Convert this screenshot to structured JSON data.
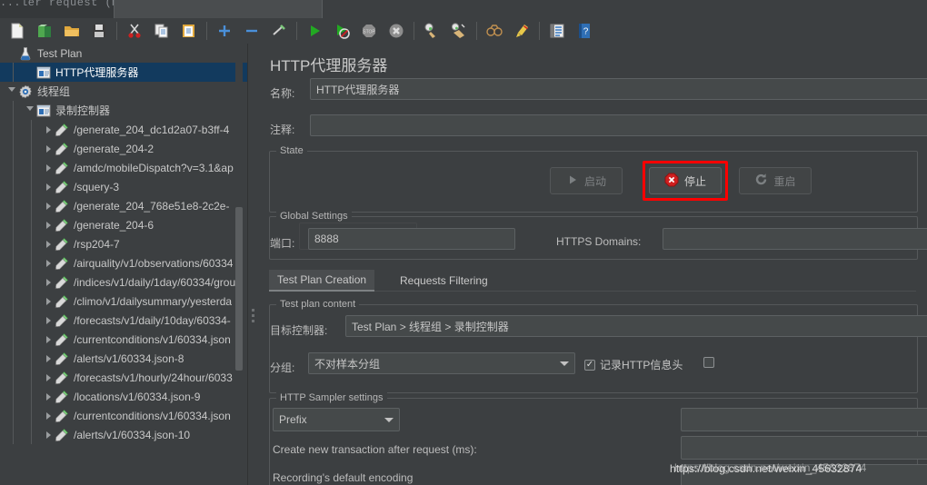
{
  "window": {
    "stray_title_fragment": "...ler request (ms):"
  },
  "toolbar": {
    "items": [
      {
        "name": "new-icon",
        "glyph": "new"
      },
      {
        "name": "templates-icon",
        "glyph": "templates"
      },
      {
        "name": "open-icon",
        "glyph": "open"
      },
      {
        "name": "save-icon",
        "glyph": "save"
      },
      {
        "name": "separator",
        "glyph": "sep"
      },
      {
        "name": "cut-icon",
        "glyph": "cut"
      },
      {
        "name": "copy-icon",
        "glyph": "copy"
      },
      {
        "name": "paste-icon",
        "glyph": "paste"
      },
      {
        "name": "separator",
        "glyph": "sep"
      },
      {
        "name": "expand-all-icon",
        "glyph": "plus"
      },
      {
        "name": "collapse-all-icon",
        "glyph": "minus"
      },
      {
        "name": "toggle-icon",
        "glyph": "toggle"
      },
      {
        "name": "separator",
        "glyph": "sep"
      },
      {
        "name": "start-icon",
        "glyph": "start"
      },
      {
        "name": "start-no-pauses-icon",
        "glyph": "start-no-pause"
      },
      {
        "name": "stop-icon",
        "glyph": "stop"
      },
      {
        "name": "shutdown-icon",
        "glyph": "shutdown"
      },
      {
        "name": "separator",
        "glyph": "sep"
      },
      {
        "name": "clear-icon",
        "glyph": "clear"
      },
      {
        "name": "clear-all-icon",
        "glyph": "clear-all"
      },
      {
        "name": "separator",
        "glyph": "sep"
      },
      {
        "name": "search-icon",
        "glyph": "search"
      },
      {
        "name": "reset-search-icon",
        "glyph": "reset-search"
      },
      {
        "name": "separator",
        "glyph": "sep"
      },
      {
        "name": "function-helper-icon",
        "glyph": "function-helper"
      },
      {
        "name": "help-icon",
        "glyph": "help"
      }
    ]
  },
  "tree": {
    "nodes": [
      {
        "label": "Test Plan",
        "icon": "test-plan-icon",
        "depth": 0,
        "twisty": "none",
        "selected": false
      },
      {
        "label": "HTTP代理服务器",
        "icon": "proxy-icon",
        "depth": 1,
        "twisty": "none",
        "selected": true
      },
      {
        "label": "线程组",
        "icon": "thread-group-icon",
        "depth": 0,
        "twisty": "down",
        "selected": false
      },
      {
        "label": "录制控制器",
        "icon": "recording-controller-icon",
        "depth": 1,
        "twisty": "down",
        "selected": false
      },
      {
        "label": "/generate_204_dc1d2a07-b3ff-4",
        "icon": "http-sampler-icon",
        "depth": 2,
        "twisty": "right",
        "selected": false
      },
      {
        "label": "/generate_204-2",
        "icon": "http-sampler-icon",
        "depth": 2,
        "twisty": "right",
        "selected": false
      },
      {
        "label": "/amdc/mobileDispatch?v=3.1&ap",
        "icon": "http-sampler-icon",
        "depth": 2,
        "twisty": "right",
        "selected": false
      },
      {
        "label": "/squery-3",
        "icon": "http-sampler-icon",
        "depth": 2,
        "twisty": "right",
        "selected": false
      },
      {
        "label": "/generate_204_768e51e8-2c2e-",
        "icon": "http-sampler-icon",
        "depth": 2,
        "twisty": "right",
        "selected": false
      },
      {
        "label": "/generate_204-6",
        "icon": "http-sampler-icon",
        "depth": 2,
        "twisty": "right",
        "selected": false
      },
      {
        "label": "/rsp204-7",
        "icon": "http-sampler-icon",
        "depth": 2,
        "twisty": "right",
        "selected": false
      },
      {
        "label": "/airquality/v1/observations/60334",
        "icon": "http-sampler-icon",
        "depth": 2,
        "twisty": "right",
        "selected": false
      },
      {
        "label": "/indices/v1/daily/1day/60334/grou",
        "icon": "http-sampler-icon",
        "depth": 2,
        "twisty": "right",
        "selected": false
      },
      {
        "label": "/climo/v1/dailysummary/yesterda",
        "icon": "http-sampler-icon",
        "depth": 2,
        "twisty": "right",
        "selected": false
      },
      {
        "label": "/forecasts/v1/daily/10day/60334-",
        "icon": "http-sampler-icon",
        "depth": 2,
        "twisty": "right",
        "selected": false
      },
      {
        "label": "/currentconditions/v1/60334.json",
        "icon": "http-sampler-icon",
        "depth": 2,
        "twisty": "right",
        "selected": false
      },
      {
        "label": "/alerts/v1/60334.json-8",
        "icon": "http-sampler-icon",
        "depth": 2,
        "twisty": "right",
        "selected": false
      },
      {
        "label": "/forecasts/v1/hourly/24hour/6033",
        "icon": "http-sampler-icon",
        "depth": 2,
        "twisty": "right",
        "selected": false
      },
      {
        "label": "/locations/v1/60334.json-9",
        "icon": "http-sampler-icon",
        "depth": 2,
        "twisty": "right",
        "selected": false
      },
      {
        "label": "/currentconditions/v1/60334.json",
        "icon": "http-sampler-icon",
        "depth": 2,
        "twisty": "right",
        "selected": false
      },
      {
        "label": "/alerts/v1/60334.json-10",
        "icon": "http-sampler-icon",
        "depth": 2,
        "twisty": "right",
        "selected": false
      }
    ]
  },
  "main": {
    "title": "HTTP代理服务器",
    "name_label": "名称:",
    "name_value": "HTTP代理服务器",
    "comment_label": "注释:",
    "comment_value": "",
    "state": {
      "group_title": "State",
      "start_label": "启动",
      "stop_label": "停止",
      "restart_label": "重启"
    },
    "global_settings": {
      "group_title": "Global Settings",
      "port_label": "端口:",
      "port_value": "8888",
      "https_domains_label": "HTTPS Domains:",
      "https_domains_value": ""
    },
    "tabs": [
      {
        "label": "Test Plan Creation",
        "active": true
      },
      {
        "label": "Requests Filtering",
        "active": false
      }
    ],
    "test_plan_content": {
      "group_title": "Test plan content",
      "target_controller_label": "目标控制器:",
      "target_controller_value": "Test Plan > 线程组 > 录制控制器",
      "grouping_label": "分组:",
      "grouping_value": "不对样本分组",
      "capture_headers_label": "记录HTTP信息头",
      "capture_headers_checked": true,
      "extra_checkbox_checked": false
    },
    "http_sampler_settings": {
      "group_title": "HTTP Sampler settings",
      "prefix_mode_value": "Prefix",
      "prefix_value": "",
      "transaction_label": "Create new transaction after request (ms):",
      "transaction_value": "",
      "encoding_label": "Recording's default encoding",
      "encoding_value": ""
    }
  },
  "watermark": {
    "text": "https://blog.csdn.net/weixin_45632874"
  },
  "colors": {
    "bg": "#3c3f41",
    "panel": "#45494a",
    "selection": "#123a5e",
    "border": "#5c6062",
    "text": "#bbbbbb",
    "highlight_red": "#ff0000"
  }
}
